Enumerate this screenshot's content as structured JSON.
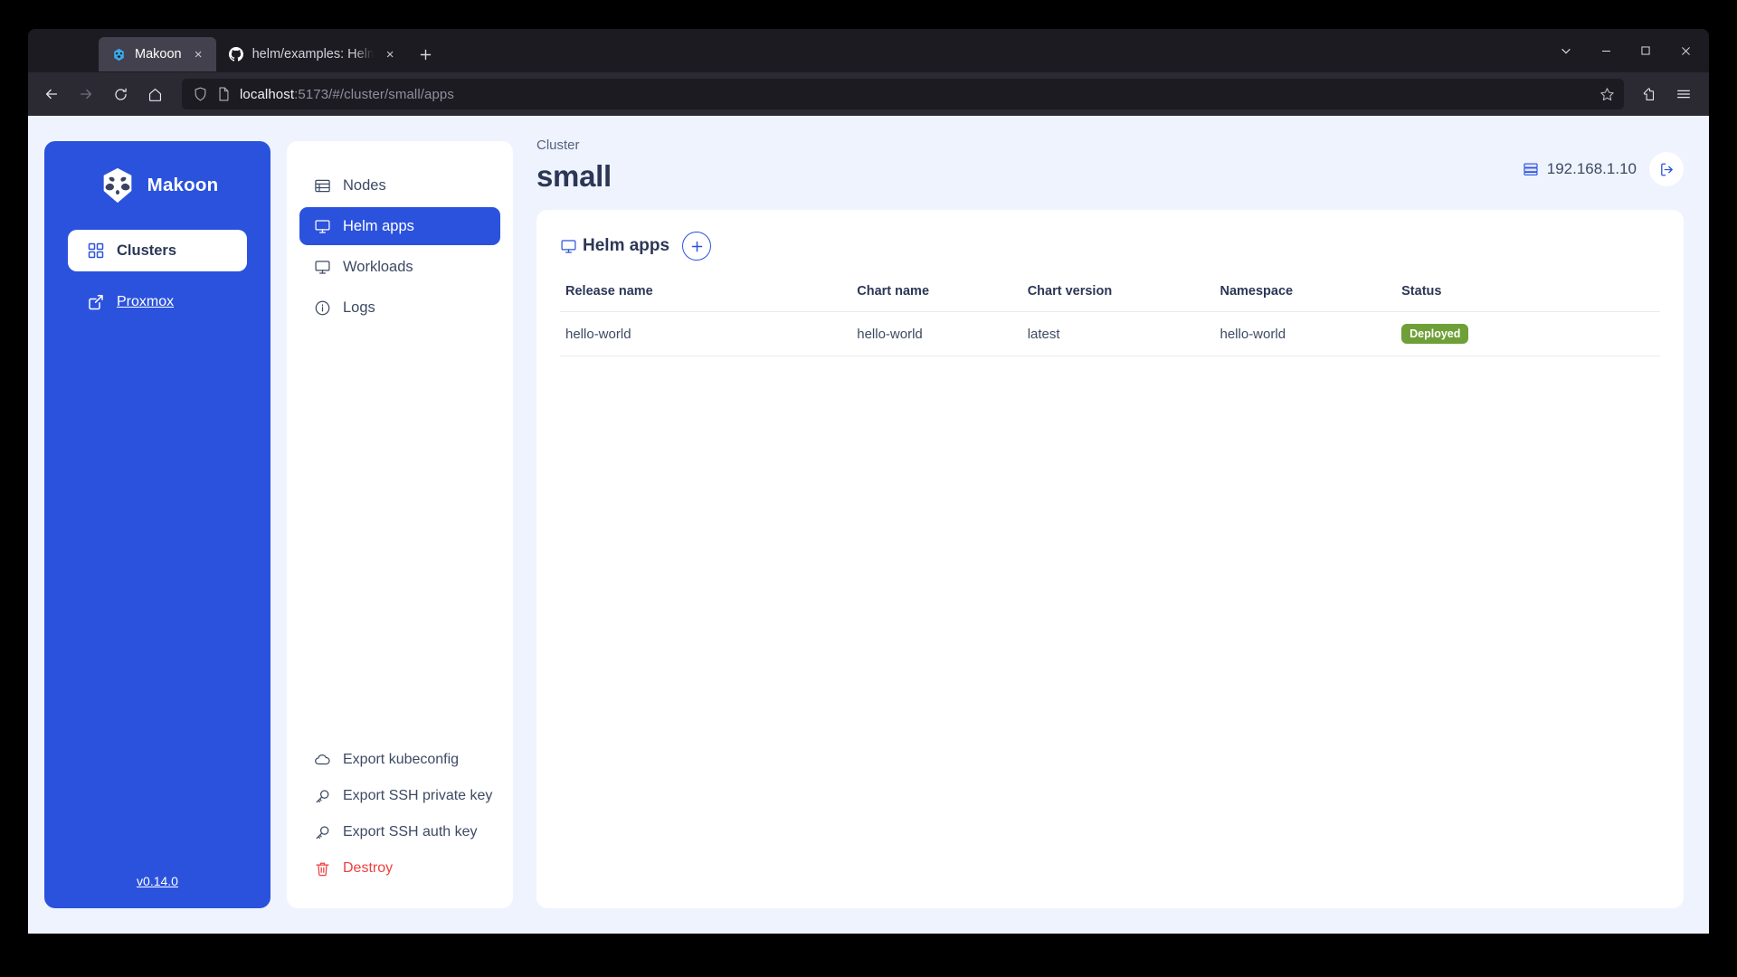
{
  "browser": {
    "tabs": [
      {
        "title": "Makoon",
        "favicon": "makoon-icon",
        "active": true
      },
      {
        "title": "helm/examples: Helm char",
        "favicon": "github-icon",
        "active": false
      }
    ],
    "new_tab_label": "+",
    "close_label": "×",
    "nav": {
      "back": "back-arrow-icon",
      "forward": "forward-arrow-icon",
      "reload": "reload-icon",
      "home": "home-icon"
    },
    "url": {
      "host": "localhost",
      "path": ":5173/#/cluster/small/apps",
      "full": "localhost:5173/#/cluster/small/apps"
    },
    "toolbar": {
      "bookmark": "star-icon",
      "extensions": "extensions-icon",
      "menu": "hamburger-menu-icon"
    },
    "window_controls": {
      "tab_list": "chevron-down-icon",
      "minimize": "minimize-icon",
      "maximize": "maximize-icon",
      "close": "close-icon"
    }
  },
  "rail": {
    "brand": "Makoon",
    "clusters_label": "Clusters",
    "proxmox_label": "Proxmox",
    "version": "v0.14.0"
  },
  "subnav": {
    "items": [
      {
        "label": "Nodes",
        "icon": "table-rows-icon",
        "active": false
      },
      {
        "label": "Helm apps",
        "icon": "monitor-icon",
        "active": true
      },
      {
        "label": "Workloads",
        "icon": "monitor-icon",
        "active": false
      },
      {
        "label": "Logs",
        "icon": "info-circle-icon",
        "active": false
      }
    ],
    "actions": [
      {
        "label": "Export kubeconfig",
        "icon": "cloud-icon",
        "danger": false
      },
      {
        "label": "Export SSH private key",
        "icon": "key-icon",
        "danger": false
      },
      {
        "label": "Export SSH auth key",
        "icon": "key-icon",
        "danger": false
      },
      {
        "label": "Destroy",
        "icon": "trash-icon",
        "danger": true
      }
    ]
  },
  "header": {
    "breadcrumb": "Cluster",
    "title": "small",
    "server_ip": "192.168.1.10",
    "logout_icon": "logout-icon"
  },
  "panel": {
    "title": "Helm apps",
    "add_label": "+",
    "columns": [
      "Release name",
      "Chart name",
      "Chart version",
      "Namespace",
      "Status"
    ],
    "rows": [
      {
        "release_name": "hello-world",
        "chart_name": "hello-world",
        "chart_version": "latest",
        "namespace": "hello-world",
        "status": "Deployed"
      }
    ]
  },
  "colors": {
    "brand_blue": "#2b52dd",
    "page_bg": "#eff3fe",
    "status_green": "#6f9f37",
    "danger_red": "#f03e3e",
    "text_dark": "#2c3756"
  }
}
